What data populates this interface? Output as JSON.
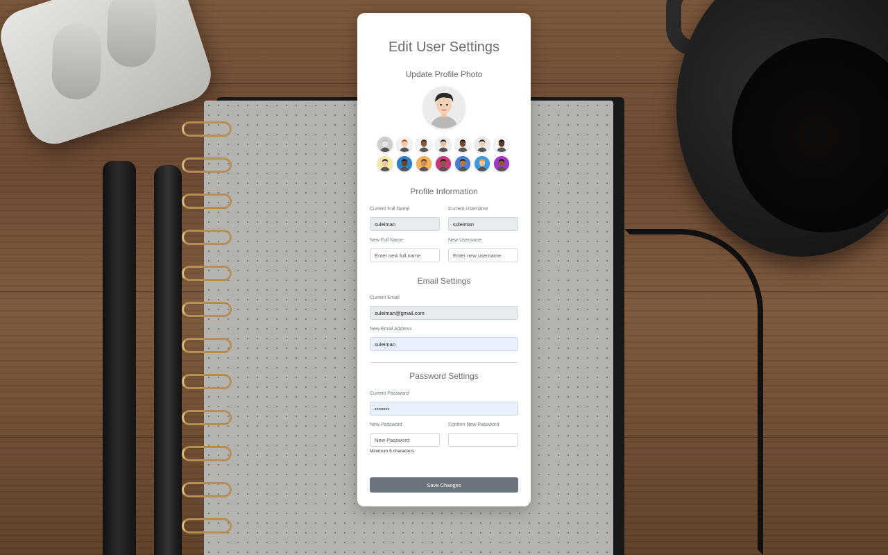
{
  "page": {
    "title": "Edit User Settings"
  },
  "photo": {
    "section_title": "Update Profile Photo",
    "avatars": [
      {
        "name": "avatar-gray-default",
        "bg": "#cfcfcf",
        "skin": "#e6e6e6",
        "hair": "#bdbdbd"
      },
      {
        "name": "avatar-redhead",
        "bg": "#f2f2f2",
        "skin": "#f1c6a2",
        "hair": "#c8461e"
      },
      {
        "name": "avatar-curly",
        "bg": "#f5f5f5",
        "skin": "#8a5a3b",
        "hair": "#3b2416"
      },
      {
        "name": "avatar-hat",
        "bg": "#f0f0f0",
        "skin": "#e9c19e",
        "hair": "#23313a"
      },
      {
        "name": "avatar-dark-hair",
        "bg": "#f3f3f3",
        "skin": "#7a4a2e",
        "hair": "#1f1410"
      },
      {
        "name": "avatar-selected-man",
        "bg": "#eaeaea",
        "skin": "#f3d0b3",
        "hair": "#2b2b2b"
      },
      {
        "name": "avatar-braids",
        "bg": "#f5f5f5",
        "skin": "#5a3a25",
        "hair": "#111111"
      },
      {
        "name": "avatar-sunglasses",
        "bg": "#f4e9a8",
        "skin": "#f2c9a3",
        "hair": "#2a2a2a"
      },
      {
        "name": "avatar-beard",
        "bg": "#2f80c8",
        "skin": "#6b4128",
        "hair": "#1a1a1a"
      },
      {
        "name": "avatar-glasses",
        "bg": "#f3b25e",
        "skin": "#c98a5c",
        "hair": "#6a3a1a"
      },
      {
        "name": "avatar-pink",
        "bg": "#c6387a",
        "skin": "#8a5a3b",
        "hair": "#2a1a10"
      },
      {
        "name": "avatar-curly-woman",
        "bg": "#4a7fd8",
        "skin": "#b8784e",
        "hair": "#3a1f12"
      },
      {
        "name": "avatar-blonde",
        "bg": "#3a9be0",
        "skin": "#f0c19c",
        "hair": "#e3a23a"
      },
      {
        "name": "avatar-purple",
        "bg": "#9b3cc8",
        "skin": "#8d5634",
        "hair": "#1a1a1a"
      }
    ]
  },
  "profile": {
    "section_title": "Profile Information",
    "current_full_name_label": "Current Full Name",
    "current_full_name_value": "suleiman",
    "current_username_label": "Current Username",
    "current_username_value": "suleiman",
    "new_full_name_label": "New Full Name",
    "new_full_name_placeholder": "Enter new full name",
    "new_username_label": "New Username",
    "new_username_placeholder": "Enter new username"
  },
  "email": {
    "section_title": "Email Settings",
    "current_email_label": "Current Email",
    "current_email_value": "suleiman@gmail.com",
    "new_email_label": "New Email Address",
    "new_email_value": "suleiman"
  },
  "password": {
    "section_title": "Password Settings",
    "current_password_label": "Current Password",
    "current_password_value": "••••••••",
    "new_password_label": "New Password",
    "new_password_placeholder": "New Password",
    "confirm_password_label": "Confirm New Password",
    "confirm_password_placeholder": "",
    "hint": "Minimum 6 characters"
  },
  "actions": {
    "save_label": "Save Changes"
  },
  "colors": {
    "card_bg": "#ffffff",
    "readonly_bg": "#e9ecef",
    "autofill_bg": "#e8f0fe",
    "button_bg": "#6c757d",
    "heading_text": "#666b70"
  }
}
